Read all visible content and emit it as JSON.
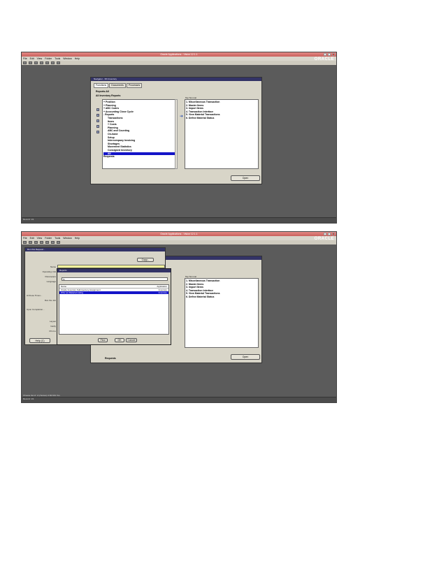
{
  "screens": [
    {
      "window_title": "Oracle Applications - Vision 12.1.1",
      "menu": [
        "File",
        "Edit",
        "View",
        "Folder",
        "Tools",
        "Window",
        "Help"
      ],
      "logo": "ORACLE",
      "navigator": {
        "title": "Navigator - 3% Inventory",
        "tabs": [
          "Functions",
          "Documents",
          "Processes"
        ],
        "path": "Reports:All",
        "heading": "All Inventory Reports",
        "tree": [
          "+ Position",
          "+ Planning",
          "+ ABC Codes",
          "+ Accounting Close Cycle",
          "- Reports",
          "Transactions",
          "Items",
          "+ Costs",
          "Planning",
          "ABC and Counting",
          "On-hand",
          "Setup",
          "Intercompany Invoicing",
          "Shortages",
          "Movement Statistics",
          "Consigned Inventory",
          "All",
          "Requests"
        ],
        "selected": "All",
        "top_ten_label": "Top Ten List",
        "top_ten": [
          "1. Miscellaneous Transaction",
          "2. Master Items",
          "3. Import Items",
          "4. Transaction Interface",
          "5. View Material Transactions",
          "6. Define Material Status"
        ],
        "open_button": "Open"
      },
      "status": "Record: 1/1"
    },
    {
      "window_title": "Oracle Applications - Vision 12.1.1",
      "menu": [
        "File",
        "Edit",
        "View",
        "Folder",
        "Tools",
        "Window",
        "Help"
      ],
      "logo": "ORACLE",
      "run_window": {
        "title": "Run this Request...",
        "copy_button": "Copy...",
        "labels": [
          "Name",
          "Operating Unit",
          "Parameters",
          "Language",
          "At these Times...",
          "Run the Job",
          "Upon Completion...",
          "Layout",
          "Notify",
          "Print to"
        ],
        "help_button": "Help (C)"
      },
      "reports_dialog": {
        "title": "Reports",
        "find_value": "%",
        "col_name": "Name",
        "col_app": "Application",
        "rows": [
          {
            "name": "Oracle Inventory Subinventory Assignment",
            "app": "Inventory"
          },
          {
            "name": "Whs Lot Material Listing",
            "app": "Inventory"
          }
        ],
        "find_button": "Find",
        "ok_button": "OK",
        "cancel_button": "Cancel"
      },
      "navigator": {
        "top_ten_label": "Top Ten List",
        "top_ten": [
          "1. Miscellaneous Transaction",
          "2. Master Items",
          "3. Import Items",
          "4. Transaction Interface",
          "5. View Material Transactions",
          "6. Define Material Status"
        ],
        "open_button": "Open",
        "requests_label": "Requests"
      },
      "status_top": "Choose list of: 2 (choices) 4.84.601 Yes",
      "status": "Record: 1/1"
    }
  ]
}
